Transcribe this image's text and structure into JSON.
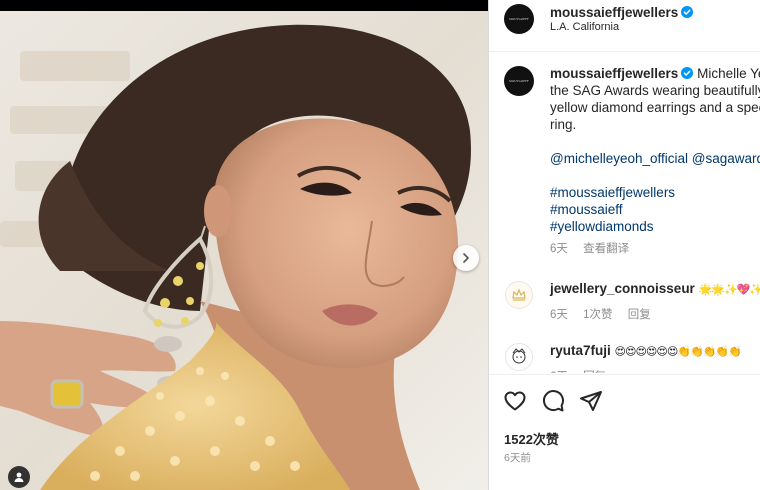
{
  "post": {
    "account": "moussaieffjewellers",
    "avatar_text": "MOUSSAIEFF",
    "location": "L.A. California",
    "caption": {
      "line1_text": "Michelle Yeoh arrived at",
      "line2": "the SAG Awards wearing beautifully set",
      "line3": "yellow diamond earrings and a spectacular",
      "line4": "ring.",
      "mentions": "@michelleyeoh_official @sagawards",
      "hashtag1": "#moussaieffjewellers",
      "hashtag2": "#moussaieff",
      "hashtag3": "#yellowdiamonds",
      "time": "6天",
      "translate": "查看翻译"
    }
  },
  "comments": [
    {
      "username": "jewellery_connoisseur",
      "text": "🌟🌟✨💖✨",
      "time": "6天",
      "likes": "1次赞",
      "reply": "回复"
    },
    {
      "username": "ryuta7fuji",
      "text": "😍😍😍😍😍😍👏👏👏👏👏",
      "time": "6天",
      "likes": "",
      "reply": "回复"
    }
  ],
  "footer": {
    "likes_count": "1522次赞",
    "time_ago": "6天前"
  },
  "icons": [
    "heart-icon",
    "comment-icon",
    "share-icon",
    "chevron-right-icon",
    "user-tag-icon",
    "verified-badge-icon"
  ],
  "colors": {
    "verified": "#0095f6",
    "link": "#00376b",
    "secondary_text": "#8e8e8e",
    "border": "#dbdbdb"
  }
}
